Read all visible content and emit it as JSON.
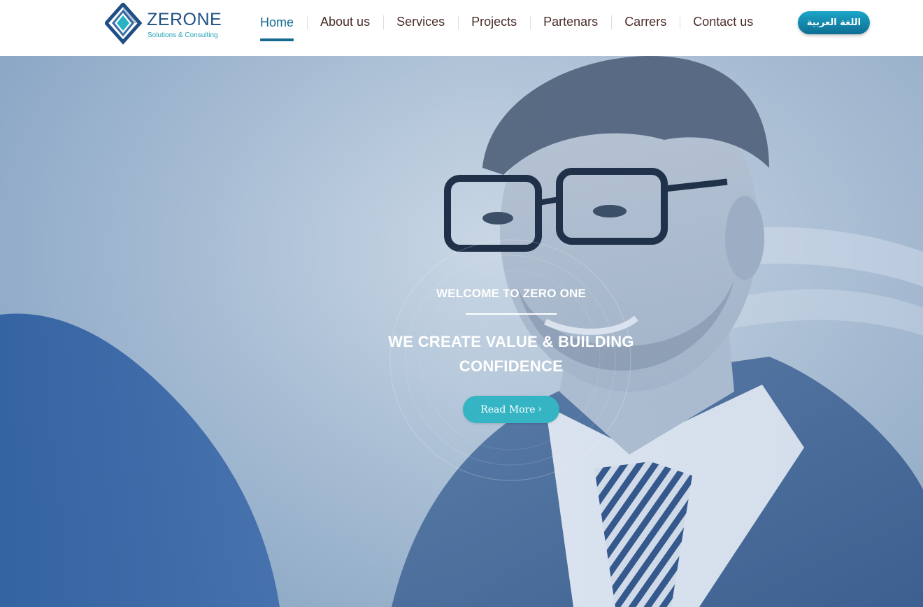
{
  "brand": {
    "name": "ZERONE",
    "tagline": "Solutions & Consulting",
    "primary_color": "#1f4f85",
    "accent_color": "#27a3b8"
  },
  "nav": {
    "items": [
      {
        "label": "Home",
        "active": true
      },
      {
        "label": "About us",
        "active": false
      },
      {
        "label": "Services",
        "active": false
      },
      {
        "label": "Projects",
        "active": false
      },
      {
        "label": "Partenars",
        "active": false
      },
      {
        "label": "Carrers",
        "active": false
      },
      {
        "label": "Contact us",
        "active": false
      }
    ],
    "active_color": "#166a92",
    "text_color": "#4a2e2a"
  },
  "language_button": {
    "label": "اللغة العربية"
  },
  "hero": {
    "welcome": "WELCOME TO ZERO ONE",
    "headline": "WE CREATE VALUE & BUILDING CONFIDENCE",
    "button_label": "Read More",
    "button_icon": "chevron-right-icon",
    "button_color": "#35b5c4"
  }
}
